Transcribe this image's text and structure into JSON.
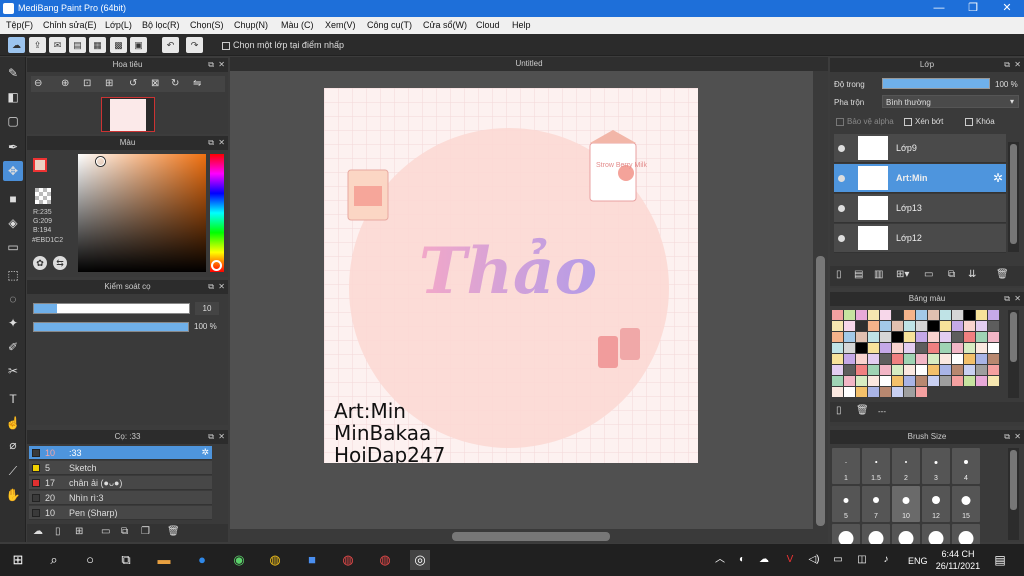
{
  "window": {
    "title": "MediBang Paint Pro (64bit)",
    "min": "—",
    "max": "❐",
    "close": "✕"
  },
  "menu": [
    "Tệp(F)",
    "Chỉnh sửa(E)",
    "Lớp(L)",
    "Bộ lọc(R)",
    "Chọn(S)",
    "Chụp(N)",
    "Màu (C)",
    "Xem(V)",
    "Công cụ(T)",
    "Cửa sổ(W)",
    "Cloud",
    "Help"
  ],
  "toolbar": {
    "option_label": "Chọn một lớp tại điểm nhấp"
  },
  "navigator": {
    "title": "Hoa tiêu"
  },
  "color": {
    "title": "Màu",
    "r": "R:235",
    "g": "G:209",
    "b": "B:194",
    "hex": "#EBD1C2",
    "main_color": "#ebd1c2"
  },
  "brush_control": {
    "title": "Kiểm soát cọ",
    "size": "10",
    "opacity": "100 %",
    "size_fraction": 0.15,
    "opacity_fraction": 1.0
  },
  "brush_list": {
    "title": "Cọ: :33",
    "items": [
      {
        "size": "10",
        "name": ":33",
        "color": "#3a3a3a",
        "selected": true
      },
      {
        "size": "5",
        "name": "Sketch",
        "color": "#f0d000",
        "selected": false
      },
      {
        "size": "17",
        "name": "chân ải (●ᴗ●)",
        "color": "#e03030",
        "selected": false
      },
      {
        "size": "20",
        "name": "Nhìn rì:3",
        "color": "#3a3a3a",
        "selected": false
      },
      {
        "size": "10",
        "name": "Pen (Sharp)",
        "color": "#3a3a3a",
        "selected": false
      }
    ]
  },
  "canvas": {
    "tab": "Untitled",
    "word": "Thảo",
    "credit1": "Art:Min",
    "credit2": "MinBakaa",
    "credit3": "HoiDap247",
    "milk_label": "Strow Berry Milk"
  },
  "layers": {
    "title": "Lớp",
    "opacity_label": "Độ trong",
    "opacity_value": "100 %",
    "blend_label": "Pha trộn",
    "blend_value": "Bình thường",
    "protect_alpha": "Bảo vệ alpha",
    "clip": "Xén bớt",
    "lock": "Khóa",
    "items": [
      {
        "name": "Lớp9",
        "selected": false
      },
      {
        "name": "Art:Min",
        "selected": true
      },
      {
        "name": "Lớp13",
        "selected": false
      },
      {
        "name": "Lớp12",
        "selected": false
      }
    ]
  },
  "palette": {
    "title": "Bảng màu",
    "footer": "---",
    "colors": [
      "#f4a0a0",
      "#f08080",
      "#f5b38a",
      "#f3c06a",
      "#f7e29a",
      "#c7e3a0",
      "#9fd3b4",
      "#a3c9e8",
      "#a9b4e6",
      "#c5a9e8",
      "#e8a9d8",
      "#f2b6c6",
      "#e0c0b0",
      "#b88870",
      "#f9d4cf",
      "#f6e7b0",
      "#d7ecc2",
      "#bfe3e6",
      "#c9d0f2",
      "#e3cdf1",
      "#f7d7ea",
      "#fbe8e0",
      "#d6d6d6",
      "#9e9e9e",
      "#5d5d5d",
      "#2f2f2f",
      "#ffffff",
      "#000000"
    ]
  },
  "brush_size": {
    "title": "Brush Size",
    "sizes": [
      "1",
      "1.5",
      "2",
      "3",
      "4",
      "5",
      "7",
      "10",
      "12",
      "15",
      "",
      "",
      "",
      "",
      ""
    ]
  },
  "taskbar": {
    "time": "6:44 CH",
    "date": "26/11/2021",
    "lang": "ENG"
  }
}
